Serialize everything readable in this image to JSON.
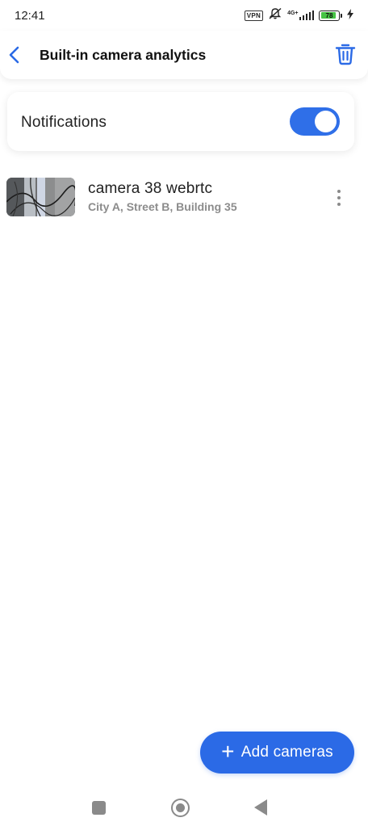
{
  "status_bar": {
    "time": "12:41",
    "vpn": "VPN",
    "network": "4G+",
    "battery_level": "78",
    "icons": [
      "vpn-icon",
      "mute-bell-icon",
      "signal-icon",
      "battery-icon",
      "charging-icon"
    ]
  },
  "header": {
    "title": "Built-in camera analytics",
    "back_icon": "chevron-left-icon",
    "delete_icon": "trash-icon"
  },
  "notifications": {
    "label": "Notifications",
    "enabled": true
  },
  "cameras": [
    {
      "name": "camera 38 webrtc",
      "address": "City A, Street B, Building 35"
    }
  ],
  "add_button": {
    "label": "Add cameras",
    "icon": "plus-icon"
  },
  "colors": {
    "accent": "#2b6ae6",
    "toggle_on": "#2f6fe8",
    "battery_fill": "#46c445",
    "secondary_text": "#8c8c8c"
  }
}
